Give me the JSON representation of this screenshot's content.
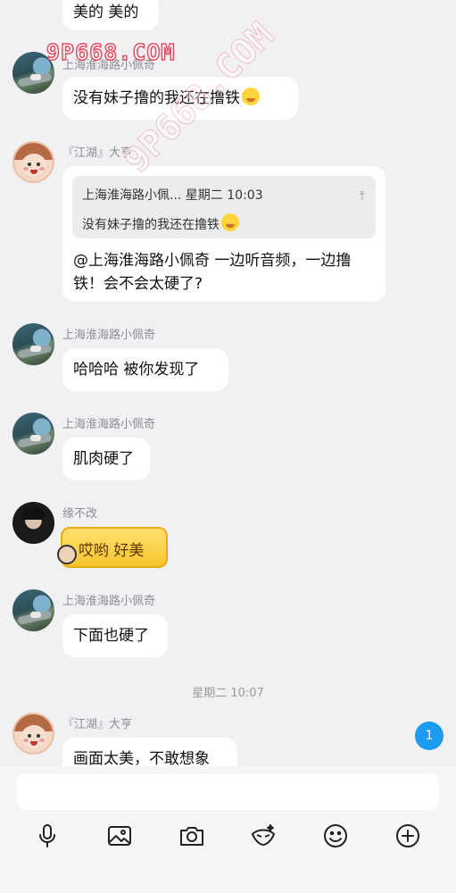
{
  "messages": {
    "m0_partial": "美的 美的",
    "m1": {
      "name": "上海淮海路小佩奇",
      "text": "没有妹子撸的我还在撸铁"
    },
    "m2": {
      "name": "『江湖』大亨",
      "quote_header": "上海淮海路小佩... 星期二 10:03",
      "quote_text": "没有妹子撸的我还在撸铁",
      "text": "@上海淮海路小佩奇 一边听音频，一边撸铁！会不会太硬了?"
    },
    "m3": {
      "name": "上海淮海路小佩奇",
      "text": "哈哈哈 被你发现了"
    },
    "m4": {
      "name": "上海淮海路小佩奇",
      "text": "肌肉硬了"
    },
    "m5": {
      "name": "缘不改",
      "text": "哎哟 好美"
    },
    "m6": {
      "name": "上海淮海路小佩奇",
      "text": "下面也硬了"
    },
    "time_separator": "星期二 10:07",
    "m7": {
      "name": "『江湖』大亨",
      "text": "画面太美，不敢想象"
    }
  },
  "watermark": {
    "text": "9P668.COM"
  },
  "unread_badge": "1",
  "input": {
    "placeholder": ""
  },
  "toolbar_icons": [
    "microphone-icon",
    "image-icon",
    "camera-icon",
    "sticker-icon",
    "emoji-icon",
    "plus-icon"
  ],
  "colors": {
    "badge": "#1d9bf0",
    "background": "#f1f1f3",
    "bubble": "#ffffff"
  }
}
